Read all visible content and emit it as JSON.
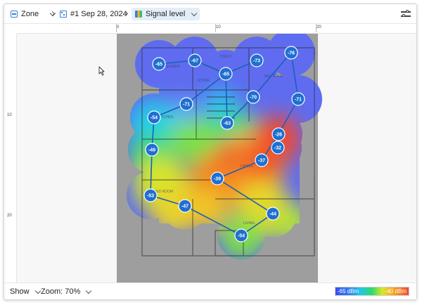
{
  "breadcrumb": {
    "zone_label": "Zone",
    "survey_label": "#1 Sep 28, 2024",
    "view_label": "Signal level"
  },
  "icons": {
    "zone": "floor-plan-icon",
    "survey": "calendar-icon",
    "view": "signal-map-icon",
    "settings": "sliders-icon",
    "cursor": "mouse-cursor-icon"
  },
  "rulers": {
    "top_ticks": [
      "0",
      "10",
      "20"
    ],
    "left_ticks": [
      "10",
      "20"
    ]
  },
  "rooms": [
    "W-AREA",
    "TOILET",
    "STORE",
    "BED ROOM",
    "KITCHEN",
    "DINING",
    "BED ROOM",
    "LIVING"
  ],
  "measurements": [
    {
      "label": "-65",
      "value": -65
    },
    {
      "label": "-67",
      "value": -67
    },
    {
      "label": "-65",
      "value": -65
    },
    {
      "label": "-73",
      "value": -73
    },
    {
      "label": "-76",
      "value": -76
    },
    {
      "label": "-71",
      "value": -71
    },
    {
      "label": "-70",
      "value": -70
    },
    {
      "label": "-71",
      "value": -71
    },
    {
      "label": "-54",
      "value": -54
    },
    {
      "label": "-63",
      "value": -63
    },
    {
      "label": "-26",
      "value": -26
    },
    {
      "label": "-49",
      "value": -49
    },
    {
      "label": "-32",
      "value": -32
    },
    {
      "label": "-37",
      "value": -37
    },
    {
      "label": "-39",
      "value": -39
    },
    {
      "label": "-53",
      "value": -53
    },
    {
      "label": "-47",
      "value": -47
    },
    {
      "label": "-44",
      "value": -44
    },
    {
      "label": "-54",
      "value": -54
    }
  ],
  "bottom": {
    "show_label": "Show",
    "zoom_label": "Zoom: 70%"
  },
  "legend": {
    "low_label": "-65 dBm",
    "high_label": "-40 dBm"
  },
  "colors": {
    "accent": "#2d6fd6",
    "marker": "#1f6fd1",
    "path": "#1c5fb8"
  }
}
